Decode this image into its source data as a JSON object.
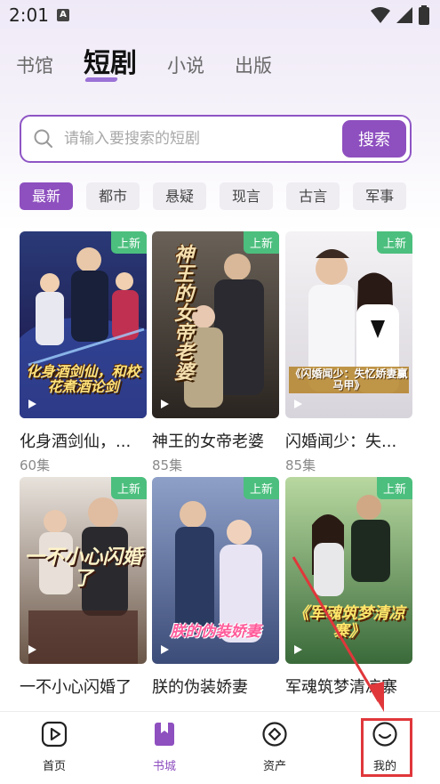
{
  "status_bar": {
    "time": "2:01",
    "notification_letter": "A"
  },
  "top_tabs": [
    {
      "label": "书馆",
      "active": false
    },
    {
      "label": "短剧",
      "active": true
    },
    {
      "label": "小说",
      "active": false
    },
    {
      "label": "出版",
      "active": false
    }
  ],
  "search": {
    "placeholder": "请输入要搜索的短剧",
    "button_label": "搜索"
  },
  "categories": [
    "最新",
    "都市",
    "悬疑",
    "现言",
    "古言",
    "军事"
  ],
  "dramas": [
    {
      "title": "化身酒剑仙，...",
      "episodes": "60集",
      "badge": "上新",
      "poster_text": "化身酒剑仙，和校花煮酒论剑"
    },
    {
      "title": "神王的女帝老婆",
      "episodes": "85集",
      "badge": "上新",
      "poster_text": "神王的女帝老婆"
    },
    {
      "title": "闪婚闻少：失...",
      "episodes": "85集",
      "badge": "上新",
      "poster_text": "《闪婚闻少：失忆娇妻赢马甲》"
    },
    {
      "title": "一不小心闪婚了",
      "episodes": "",
      "badge": "上新",
      "poster_text": "一不小心闪婚了"
    },
    {
      "title": "朕的伪装娇妻",
      "episodes": "",
      "badge": "上新",
      "poster_text": "朕的伪装娇妻"
    },
    {
      "title": "军魂筑梦清凉寨",
      "episodes": "",
      "badge": "上新",
      "poster_text": "《军魂筑梦清凉寨》"
    }
  ],
  "bottom_nav": [
    {
      "label": "首页",
      "icon": "play-square-icon",
      "active": false
    },
    {
      "label": "书城",
      "icon": "bookmark-icon",
      "active": true
    },
    {
      "label": "资产",
      "icon": "diamond-circle-icon",
      "active": false
    },
    {
      "label": "我的",
      "icon": "smile-face-icon",
      "active": false
    }
  ],
  "colors": {
    "accent": "#8e4fbf",
    "badge": "#4cbf7e",
    "annotation": "#e0373b"
  }
}
